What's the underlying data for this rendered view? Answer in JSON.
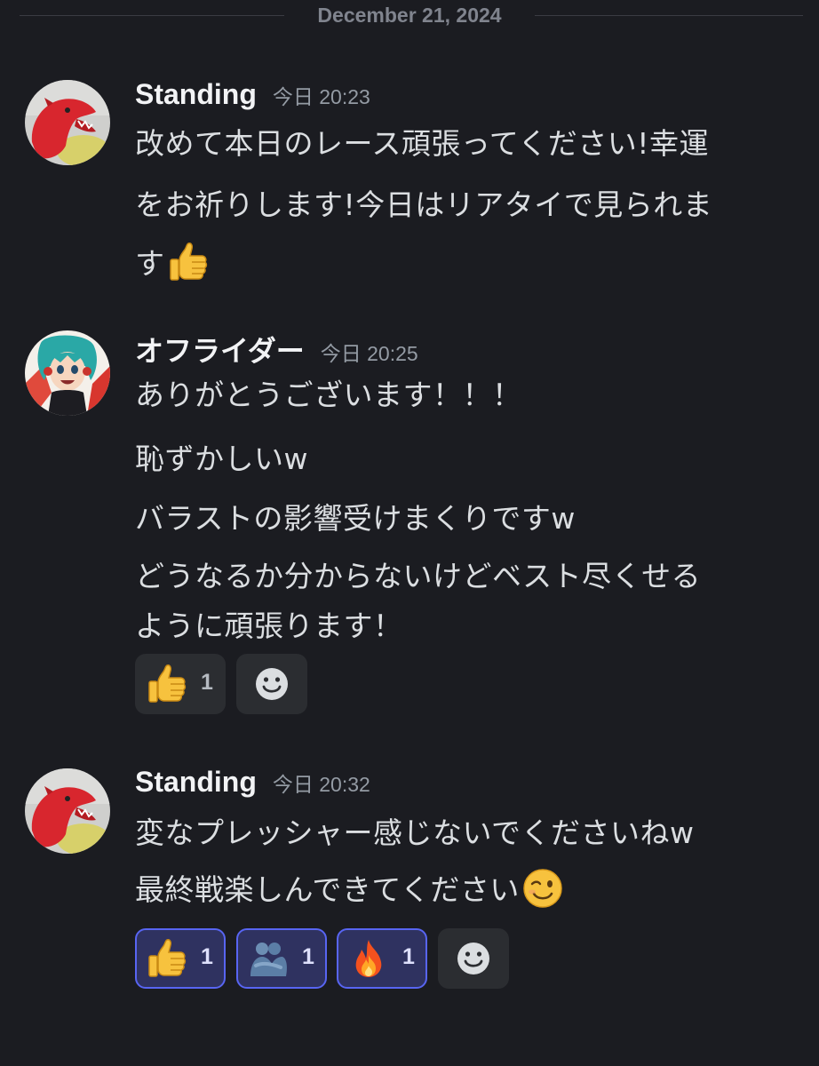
{
  "date_divider": "December 21, 2024",
  "messages": [
    {
      "username": "Standing",
      "timestamp": "今日 20:23",
      "avatar": "red-dinosaur-plush-avatar",
      "lines": [
        "改めて本日のレース頑張ってください!幸運",
        "をお祈りします!今日はリアタイで見られま",
        "す"
      ],
      "trailing_emoji": "thumbs-up"
    },
    {
      "username": "オフライダー",
      "timestamp": "今日 20:25",
      "avatar": "anime-girl-teal-hair-avatar",
      "lines": [
        "ありがとうございます！！！",
        "恥ずかしいw",
        "バラストの影響受けまくりですw",
        "どうなるか分からないけどベスト尽くせる",
        "ように頑張ります！"
      ],
      "reactions": [
        {
          "emoji": "thumbs-up",
          "count": "1",
          "active": false
        }
      ]
    },
    {
      "username": "Standing",
      "timestamp": "今日 20:32",
      "avatar": "red-dinosaur-plush-avatar",
      "lines": [
        "変なプレッシャー感じないでくださいねw",
        "最終戦楽しんできてください"
      ],
      "trailing_emoji": "winking-face",
      "reactions": [
        {
          "emoji": "thumbs-up",
          "count": "1",
          "active": true
        },
        {
          "emoji": "people-hugging",
          "count": "1",
          "active": true
        },
        {
          "emoji": "fire",
          "count": "1",
          "active": true
        }
      ]
    }
  ],
  "colors": {
    "background": "#1b1c21",
    "username": "#f2f3f5",
    "timestamp": "#949ba4",
    "message_text": "#dbdee1",
    "reaction_bg": "#2b2d31",
    "reaction_active_bg": "#2f3260",
    "reaction_active_border": "#5865f2"
  }
}
